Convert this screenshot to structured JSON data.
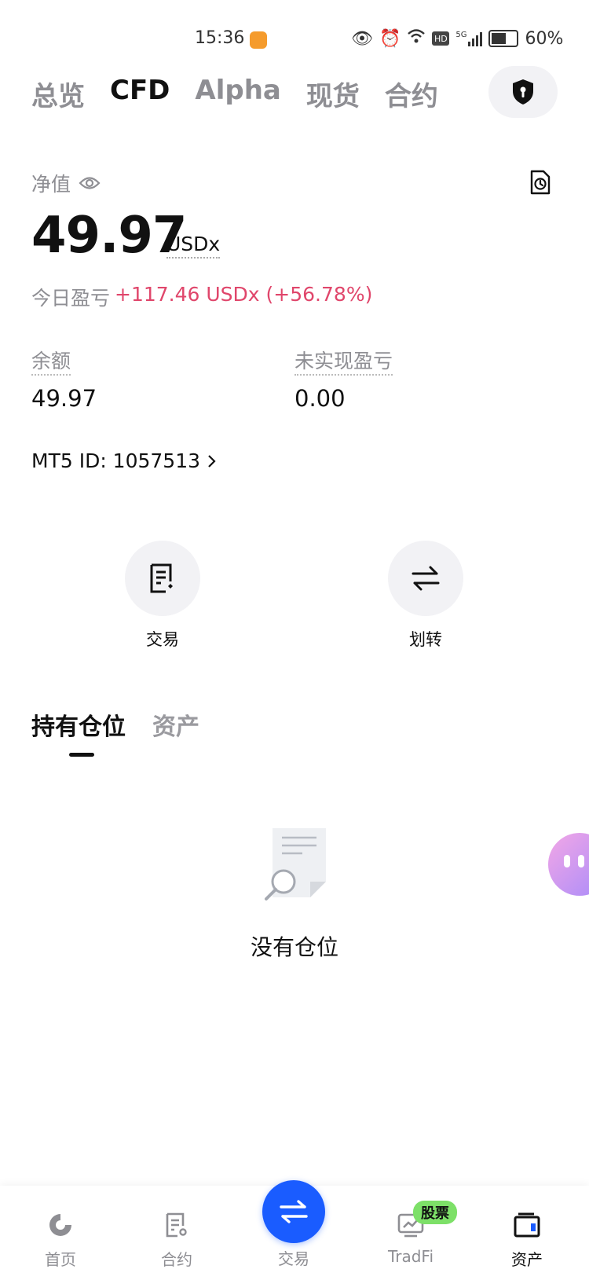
{
  "status_bar": {
    "time": "15:36",
    "network": "5G",
    "hd": "HD",
    "battery": "60%"
  },
  "top_tabs": [
    {
      "label": "总览",
      "active": false
    },
    {
      "label": "CFD",
      "active": true
    },
    {
      "label": "Alpha",
      "active": false
    },
    {
      "label": "现货",
      "active": false
    },
    {
      "label": "合约",
      "active": false
    }
  ],
  "account": {
    "net_label": "净值",
    "net_value": "49.97",
    "net_unit": "USDx",
    "pnl_label": "今日盈亏",
    "pnl_value": "+117.46 USDx (+56.78%)",
    "balance_label": "余额",
    "balance_value": "49.97",
    "unrealized_label": "未实现盈亏",
    "unrealized_value": "0.00",
    "mt5_id": "MT5 ID: 1057513"
  },
  "actions": {
    "trade_label": "交易",
    "transfer_label": "划转"
  },
  "positions": {
    "tabs": [
      {
        "label": "持有仓位",
        "active": true
      },
      {
        "label": "资产",
        "active": false
      }
    ],
    "empty_text": "没有仓位"
  },
  "bottom_nav": {
    "home": "首页",
    "futures": "合约",
    "trade": "交易",
    "tradfi": "TradFi",
    "tradfi_badge": "股票",
    "assets": "资产"
  },
  "colors": {
    "accent_blue": "#1a5cff",
    "pnl_red": "#e0466b",
    "badge_green": "#7de068"
  }
}
